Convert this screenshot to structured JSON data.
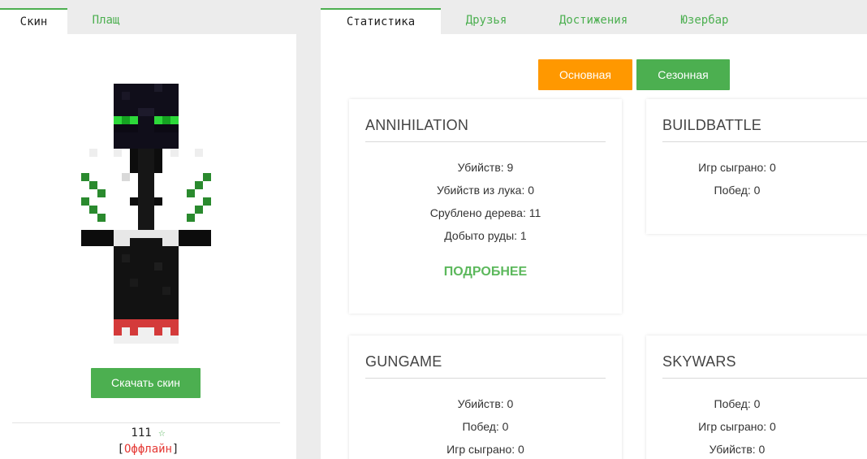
{
  "left_tabs": [
    {
      "label": "Скин",
      "active": true
    },
    {
      "label": "Плащ",
      "active": false
    }
  ],
  "download_button": "Скачать скин",
  "player": {
    "name": "111",
    "star": "☆",
    "status_open": "[",
    "status": "Оффлайн",
    "status_close": "]"
  },
  "right_tabs": [
    {
      "label": "Статистика",
      "active": true
    },
    {
      "label": "Друзья",
      "active": false
    },
    {
      "label": "Достижения",
      "active": false
    },
    {
      "label": "Юзербар",
      "active": false
    }
  ],
  "stat_mode_buttons": {
    "main": "Основная",
    "seasonal": "Сезонная"
  },
  "cards": [
    {
      "title": "ANNIHILATION",
      "stats": [
        "Убийств: 9",
        "Убийств из лука: 0",
        "Срублено дерева: 11",
        "Добыто руды: 1"
      ],
      "more": "ПОДРОБНЕЕ"
    },
    {
      "title": "BUILDBATTLE",
      "stats": [
        "Игр сыграно: 0",
        "Побед: 0"
      ]
    },
    {
      "title": "GUNGAME",
      "stats": [
        "Убийств: 0",
        "Побед: 0",
        "Игр сыграно: 0"
      ]
    },
    {
      "title": "SKYWARS",
      "stats": [
        "Побед: 0",
        "Игр сыграно: 0",
        "Убийств: 0"
      ]
    }
  ],
  "colors": {
    "accent_green": "#4caf50",
    "accent_orange": "#ff9800",
    "offline_red": "#e53935",
    "background": "#ececec"
  }
}
